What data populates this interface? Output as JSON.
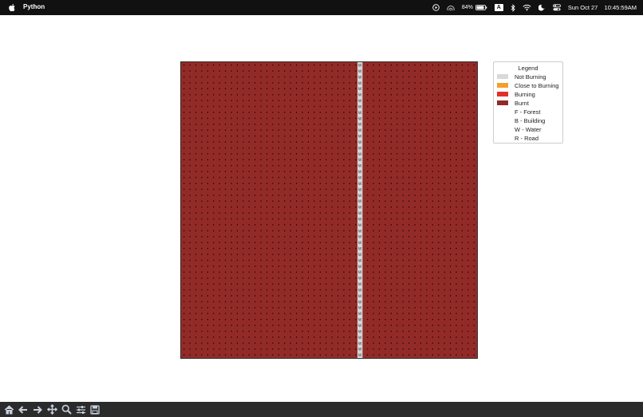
{
  "menubar": {
    "app_name": "Python",
    "battery_percent": "84%",
    "input_source": "A",
    "date": "Sun Oct 27",
    "time": "10:45:59AM"
  },
  "grid": {
    "rows": 50,
    "cols": 50,
    "fill_color": "#922b28",
    "water_column_index": 30,
    "water_label": "W",
    "water_color": "#d8d8d8"
  },
  "legend": {
    "title": "Legend",
    "items": [
      {
        "label": "Not Burning",
        "color": "#d9d9d9"
      },
      {
        "label": "Close to Burning",
        "color": "#f0a030"
      },
      {
        "label": "Burning",
        "color": "#e0302a"
      },
      {
        "label": "Burnt",
        "color": "#922b28"
      },
      {
        "label": "F - Forest"
      },
      {
        "label": "B - Building"
      },
      {
        "label": "W - Water"
      },
      {
        "label": "R - Road"
      }
    ]
  },
  "toolbar": {
    "buttons": [
      "home-icon",
      "back-arrow-icon",
      "forward-arrow-icon",
      "pan-icon",
      "zoom-icon",
      "configure-subplots-icon",
      "save-icon"
    ]
  }
}
